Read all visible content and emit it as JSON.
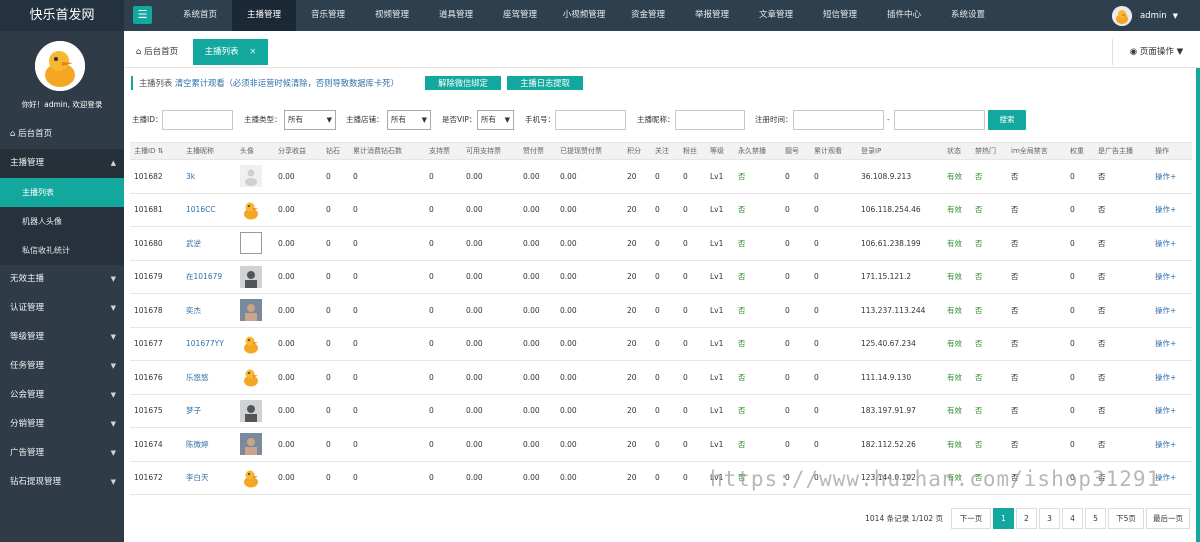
{
  "brand": "快乐首发网",
  "topnav": [
    "系统首页",
    "主播管理",
    "音乐管理",
    "视频管理",
    "道具管理",
    "座驾管理",
    "小视频管理",
    "资金管理",
    "举报管理",
    "文章管理",
    "短信管理",
    "插件中心",
    "系统设置"
  ],
  "topnav_active": 1,
  "user": {
    "name": "admin"
  },
  "sidebar": {
    "welcome": "你好！admin, 欢迎登录",
    "home": "后台首页",
    "groups": [
      {
        "label": "主播管理",
        "open": true,
        "children": [
          "主播列表",
          "机器人头像",
          "私信收礼统计"
        ]
      },
      {
        "label": "无效主播"
      },
      {
        "label": "认证管理"
      },
      {
        "label": "等级管理"
      },
      {
        "label": "任务管理"
      },
      {
        "label": "公会管理"
      },
      {
        "label": "分销管理"
      },
      {
        "label": "广告管理"
      },
      {
        "label": "钻石提现管理"
      }
    ]
  },
  "tabs": {
    "home": "后台首页",
    "current": "主播列表",
    "page_ops": "页面操作"
  },
  "headline": {
    "title": "主播列表",
    "note": "清空累计观看（必须非运营时候清除，否则导致数据库卡死）"
  },
  "actions": {
    "unbind_wechat": "解除微信绑定",
    "log_extract": "主播日志提取"
  },
  "search": {
    "id_label": "主播ID：",
    "type_label": "主播类型：",
    "type_value": "所有",
    "shop_label": "主播店铺：",
    "shop_value": "所有",
    "vip_label": "是否VIP：",
    "vip_value": "所有",
    "phone_label": "手机号：",
    "nick_label": "主播昵称：",
    "reg_label": "注册时间：",
    "dash": "-",
    "button": "搜索"
  },
  "table": {
    "columns": [
      "主播ID",
      "主播昵称",
      "头像",
      "分享收益",
      "钻石",
      "累计消费钻石数",
      "支持票",
      "可用支持票",
      "赞付票",
      "已提现赞付票",
      "积分",
      "关注",
      "粉丝",
      "等级",
      "永久禁播",
      "靓号",
      "累计观看",
      "登录IP",
      "状态",
      "禁热门",
      "im全局禁言",
      "权重",
      "是广告主播",
      "操作"
    ],
    "rows": [
      {
        "id": "101682",
        "nick": "3k",
        "avatar": "default-avatar-icon",
        "share": "0.00",
        "diamond": "0",
        "spent": "0",
        "vote": "0",
        "usable": "0.00",
        "pay": "0.00",
        "withdrawn": "0.00",
        "score": "20",
        "follow": "0",
        "fans": "0",
        "level": "Lv1",
        "banned": "否",
        "pretty": "0",
        "views": "0",
        "ip": "36.108.9.213",
        "status": "有效",
        "hot_ban": "否",
        "im_ban": "否",
        "weight": "0",
        "ad": "否",
        "op": "操作+"
      },
      {
        "id": "101681",
        "nick": "1016CC",
        "avatar": "duck-avatar-icon",
        "share": "0.00",
        "diamond": "0",
        "spent": "0",
        "vote": "0",
        "usable": "0.00",
        "pay": "0.00",
        "withdrawn": "0.00",
        "score": "20",
        "follow": "0",
        "fans": "0",
        "level": "Lv1",
        "banned": "否",
        "pretty": "0",
        "views": "0",
        "ip": "106.118.254.46",
        "status": "有效",
        "hot_ban": "否",
        "im_ban": "否",
        "weight": "0",
        "ad": "否",
        "op": "操作+"
      },
      {
        "id": "101680",
        "nick": "武逆",
        "avatar": "broken-image-icon",
        "share": "0.00",
        "diamond": "0",
        "spent": "0",
        "vote": "0",
        "usable": "0.00",
        "pay": "0.00",
        "withdrawn": "0.00",
        "score": "20",
        "follow": "0",
        "fans": "0",
        "level": "Lv1",
        "banned": "否",
        "pretty": "0",
        "views": "0",
        "ip": "106.61.238.199",
        "status": "有效",
        "hot_ban": "否",
        "im_ban": "否",
        "weight": "0",
        "ad": "否",
        "op": "操作+"
      },
      {
        "id": "101679",
        "nick": "在101679",
        "avatar": "photo-avatar-icon",
        "share": "0.00",
        "diamond": "0",
        "spent": "0",
        "vote": "0",
        "usable": "0.00",
        "pay": "0.00",
        "withdrawn": "0.00",
        "score": "20",
        "follow": "0",
        "fans": "0",
        "level": "Lv1",
        "banned": "否",
        "pretty": "0",
        "views": "0",
        "ip": "171.15.121.2",
        "status": "有效",
        "hot_ban": "否",
        "im_ban": "否",
        "weight": "0",
        "ad": "否",
        "op": "操作+"
      },
      {
        "id": "101678",
        "nick": "奕杰",
        "avatar": "photo-avatar-icon",
        "share": "0.00",
        "diamond": "0",
        "spent": "0",
        "vote": "0",
        "usable": "0.00",
        "pay": "0.00",
        "withdrawn": "0.00",
        "score": "20",
        "follow": "0",
        "fans": "0",
        "level": "Lv1",
        "banned": "否",
        "pretty": "0",
        "views": "0",
        "ip": "113.237.113.244",
        "status": "有效",
        "hot_ban": "否",
        "im_ban": "否",
        "weight": "0",
        "ad": "否",
        "op": "操作+"
      },
      {
        "id": "101677",
        "nick": "101677YY",
        "avatar": "duck-avatar-icon",
        "share": "0.00",
        "diamond": "0",
        "spent": "0",
        "vote": "0",
        "usable": "0.00",
        "pay": "0.00",
        "withdrawn": "0.00",
        "score": "20",
        "follow": "0",
        "fans": "0",
        "level": "Lv1",
        "banned": "否",
        "pretty": "0",
        "views": "0",
        "ip": "125.40.67.234",
        "status": "有效",
        "hot_ban": "否",
        "im_ban": "否",
        "weight": "0",
        "ad": "否",
        "op": "操作+"
      },
      {
        "id": "101676",
        "nick": "乐悠悠",
        "avatar": "duck-avatar-icon",
        "share": "0.00",
        "diamond": "0",
        "spent": "0",
        "vote": "0",
        "usable": "0.00",
        "pay": "0.00",
        "withdrawn": "0.00",
        "score": "20",
        "follow": "0",
        "fans": "0",
        "level": "Lv1",
        "banned": "否",
        "pretty": "0",
        "views": "0",
        "ip": "111.14.9.130",
        "status": "有效",
        "hot_ban": "否",
        "im_ban": "否",
        "weight": "0",
        "ad": "否",
        "op": "操作+"
      },
      {
        "id": "101675",
        "nick": "梦子",
        "avatar": "photo-avatar-icon",
        "share": "0.00",
        "diamond": "0",
        "spent": "0",
        "vote": "0",
        "usable": "0.00",
        "pay": "0.00",
        "withdrawn": "0.00",
        "score": "20",
        "follow": "0",
        "fans": "0",
        "level": "Lv1",
        "banned": "否",
        "pretty": "0",
        "views": "0",
        "ip": "183.197.91.97",
        "status": "有效",
        "hot_ban": "否",
        "im_ban": "否",
        "weight": "0",
        "ad": "否",
        "op": "操作+"
      },
      {
        "id": "101674",
        "nick": "陈微婷",
        "avatar": "photo-avatar-icon",
        "share": "0.00",
        "diamond": "0",
        "spent": "0",
        "vote": "0",
        "usable": "0.00",
        "pay": "0.00",
        "withdrawn": "0.00",
        "score": "20",
        "follow": "0",
        "fans": "0",
        "level": "Lv1",
        "banned": "否",
        "pretty": "0",
        "views": "0",
        "ip": "182.112.52.26",
        "status": "有效",
        "hot_ban": "否",
        "im_ban": "否",
        "weight": "0",
        "ad": "否",
        "op": "操作+"
      },
      {
        "id": "101672",
        "nick": "李白天",
        "avatar": "duck-avatar-icon",
        "share": "0.00",
        "diamond": "0",
        "spent": "0",
        "vote": "0",
        "usable": "0.00",
        "pay": "0.00",
        "withdrawn": "0.00",
        "score": "20",
        "follow": "0",
        "fans": "0",
        "level": "Lv1",
        "banned": "否",
        "pretty": "0",
        "views": "0",
        "ip": "123.144.0.102",
        "status": "有效",
        "hot_ban": "否",
        "im_ban": "否",
        "weight": "0",
        "ad": "否",
        "op": "操作+"
      }
    ]
  },
  "pagination": {
    "info": "1014 条记录 1/102 页",
    "prev": "下一页",
    "pages": [
      "1",
      "2",
      "3",
      "4",
      "5"
    ],
    "current": "1",
    "next5": "下5页",
    "last": "最后一页"
  },
  "watermark": "https://www.huzhan.com/ishop31291",
  "colors": {
    "accent": "#13a89e",
    "topbar": "#2e3f4e",
    "sidebar": "#2f3b46",
    "link": "#2f6fa8",
    "yes_green": "#2a8f2a"
  }
}
